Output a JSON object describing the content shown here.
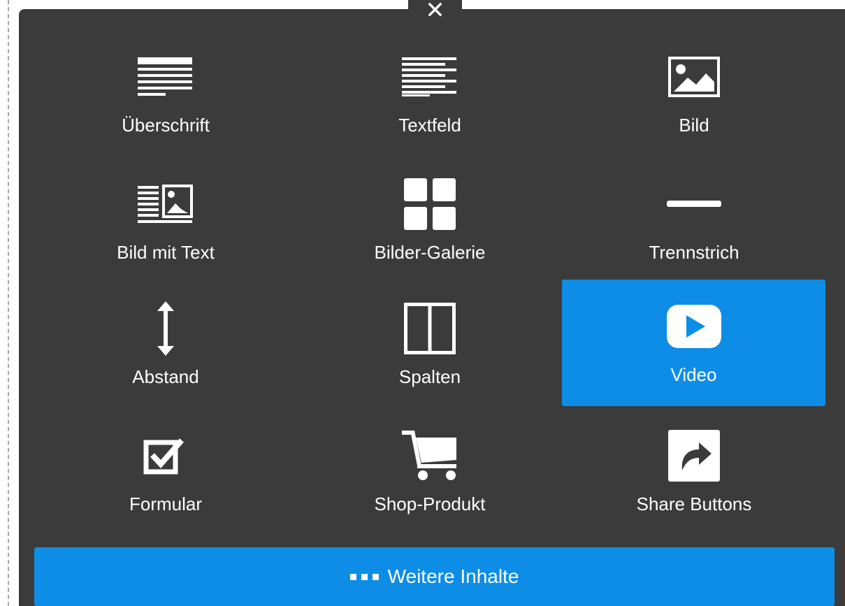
{
  "close_label": "✕",
  "tiles": [
    {
      "label": "Überschrift",
      "icon": "heading-icon"
    },
    {
      "label": "Textfeld",
      "icon": "text-lines-icon"
    },
    {
      "label": "Bild",
      "icon": "image-icon"
    },
    {
      "label": "Bild mit Text",
      "icon": "image-with-text-icon"
    },
    {
      "label": "Bilder-Galerie",
      "icon": "gallery-grid-icon"
    },
    {
      "label": "Trennstrich",
      "icon": "divider-icon"
    },
    {
      "label": "Abstand",
      "icon": "vertical-spacer-icon"
    },
    {
      "label": "Spalten",
      "icon": "columns-icon"
    },
    {
      "label": "Video",
      "icon": "play-icon",
      "selected": true
    },
    {
      "label": "Formular",
      "icon": "checkbox-icon"
    },
    {
      "label": "Shop-Produkt",
      "icon": "shopping-cart-icon"
    },
    {
      "label": "Share Buttons",
      "icon": "share-arrow-icon"
    }
  ],
  "more_button": {
    "label": "Weitere Inhalte",
    "icon": "dots-icon"
  },
  "colors": {
    "panel": "#3b3b3b",
    "accent": "#0e8de6",
    "text": "#ffffff"
  }
}
